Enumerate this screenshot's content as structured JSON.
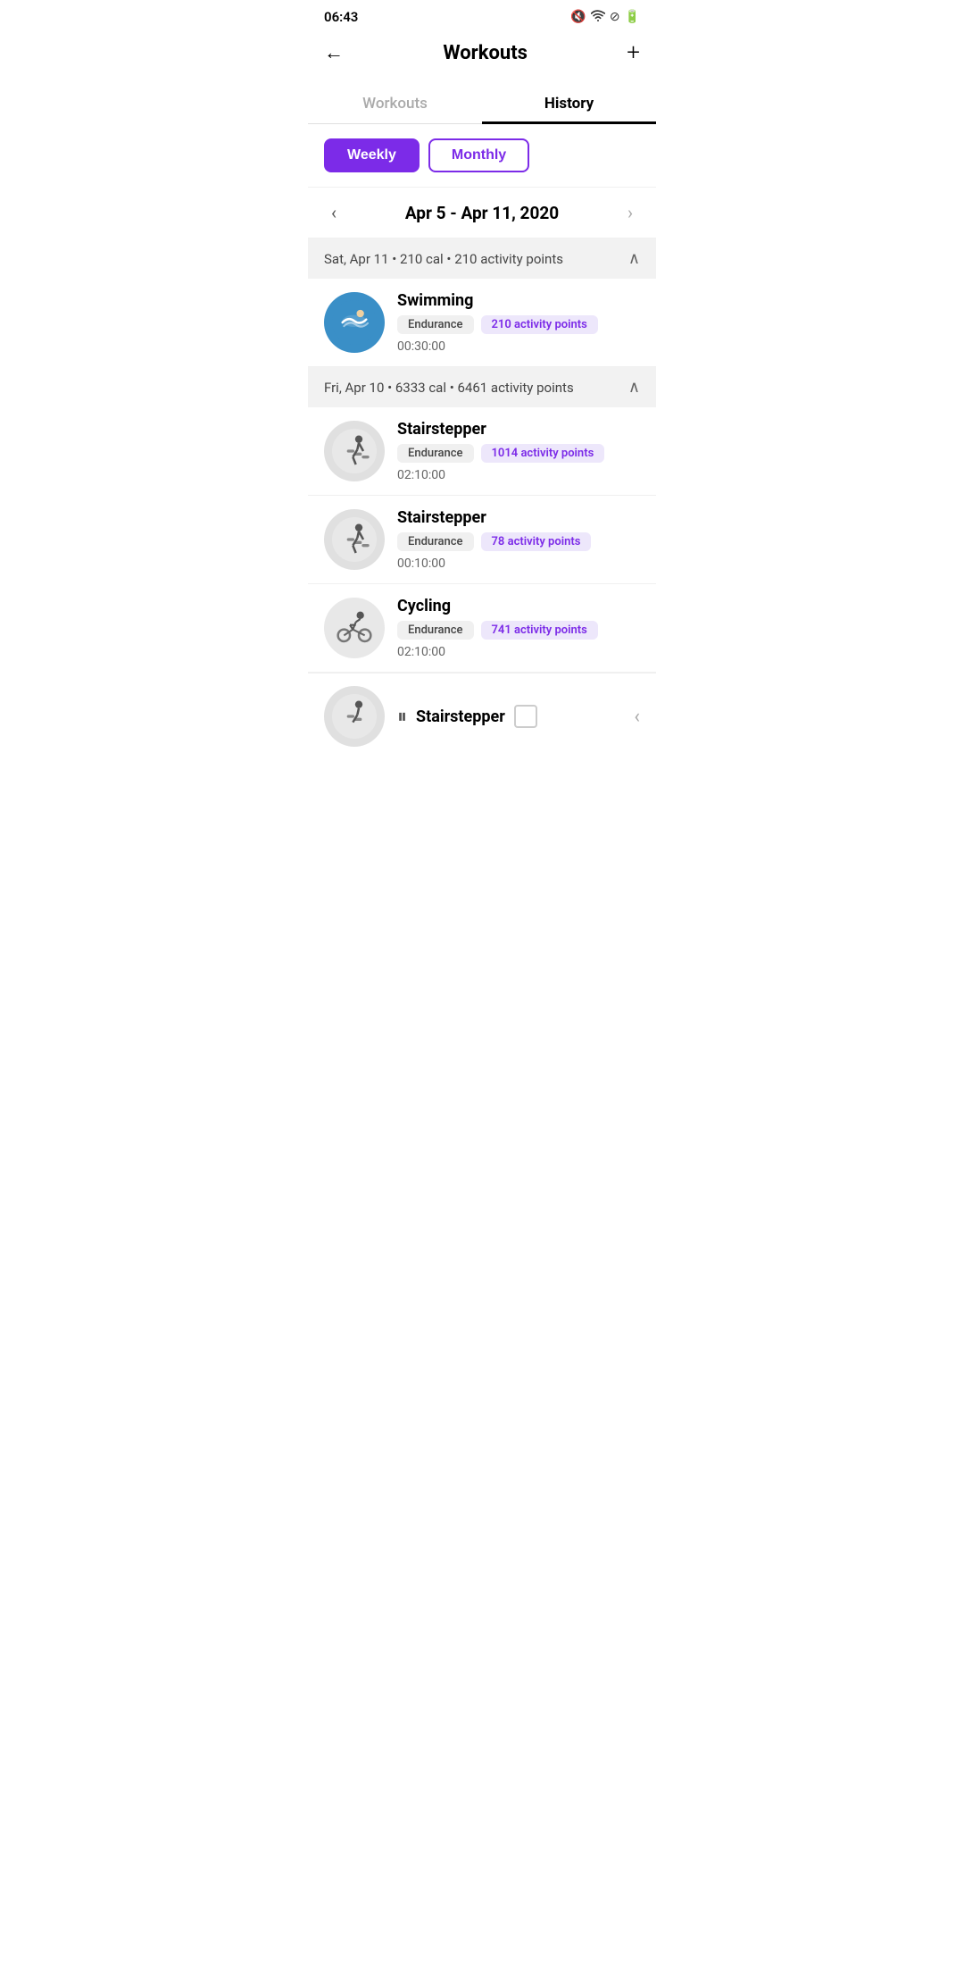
{
  "statusBar": {
    "time": "06:43",
    "icons": [
      "muted",
      "wifi",
      "dnd",
      "battery"
    ]
  },
  "header": {
    "backLabel": "←",
    "title": "Workouts",
    "addLabel": "+"
  },
  "tabs": [
    {
      "id": "workouts",
      "label": "Workouts",
      "active": false
    },
    {
      "id": "history",
      "label": "History",
      "active": true
    }
  ],
  "filterButtons": [
    {
      "id": "weekly",
      "label": "Weekly",
      "active": true
    },
    {
      "id": "monthly",
      "label": "Monthly",
      "active": false
    }
  ],
  "dateNav": {
    "prevArrow": "‹",
    "nextArrow": "›",
    "label": "Apr 5 - Apr 11, 2020"
  },
  "daySections": [
    {
      "id": "sat-apr-11",
      "header": "Sat, Apr 11  •  210 cal  •  210 activity points",
      "expanded": true,
      "workouts": [
        {
          "id": "swimming",
          "name": "Swimming",
          "tag": "Endurance",
          "points": "210 activity points",
          "duration": "00:30:00",
          "avatarType": "swimming",
          "avatarEmoji": "🏊"
        }
      ]
    },
    {
      "id": "fri-apr-10",
      "header": "Fri, Apr 10  •  6333 cal  •  6461 activity points",
      "expanded": true,
      "workouts": [
        {
          "id": "stairstepper-1",
          "name": "Stairstepper",
          "tag": "Endurance",
          "points": "1014 activity points",
          "duration": "02:10:00",
          "avatarType": "stairstepper",
          "avatarEmoji": "🚶"
        },
        {
          "id": "stairstepper-2",
          "name": "Stairstepper",
          "tag": "Endurance",
          "points": "78 activity points",
          "duration": "00:10:00",
          "avatarType": "stairstepper",
          "avatarEmoji": "🚶"
        },
        {
          "id": "cycling",
          "name": "Cycling",
          "tag": "Endurance",
          "points": "741 activity points",
          "duration": "02:10:00",
          "avatarType": "cycling",
          "avatarEmoji": "🚴"
        }
      ]
    }
  ],
  "partialItem": {
    "name": "Stairstepper",
    "avatarEmoji": "🚶",
    "avatarType": "stairstepper"
  }
}
